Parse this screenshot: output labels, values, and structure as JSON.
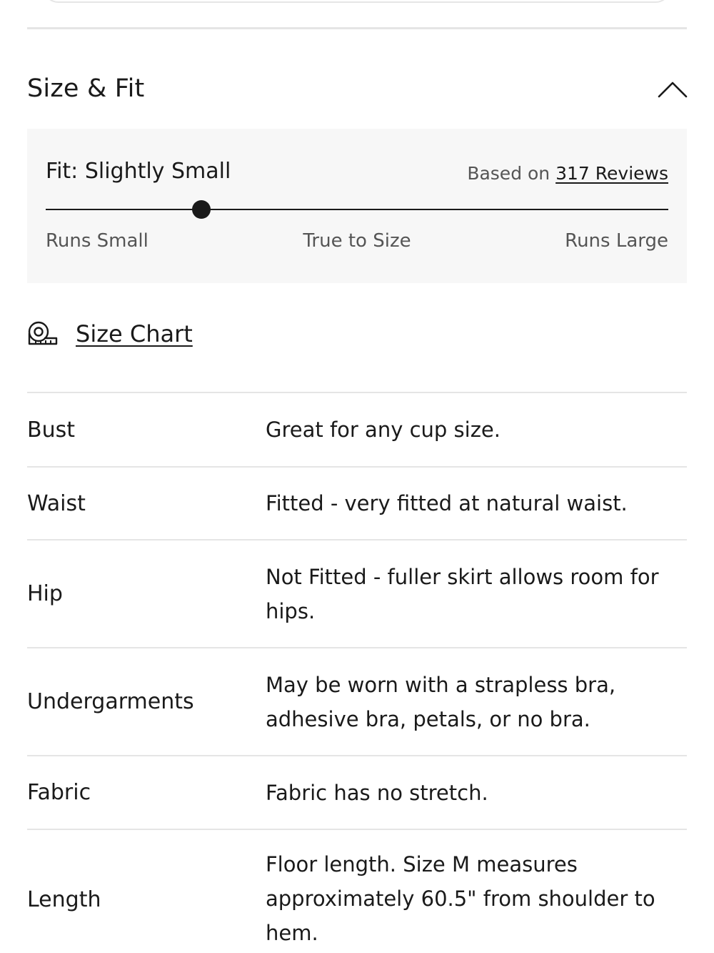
{
  "section": {
    "title": "Size & Fit"
  },
  "fit": {
    "label": "Fit: Slightly Small",
    "reviews_prefix": "Based on",
    "reviews_link": "317 Reviews",
    "position": 0.25,
    "scale": {
      "left": "Runs Small",
      "middle": "True to Size",
      "right": "Runs Large"
    }
  },
  "size_chart": {
    "icon": "measuring-tape-icon",
    "label": "Size Chart"
  },
  "fit_details": [
    {
      "label": "Bust",
      "value": "Great for any cup size."
    },
    {
      "label": "Waist",
      "value": "Fitted - very fitted at natural waist."
    },
    {
      "label": "Hip",
      "value": "Not Fitted - fuller skirt allows room for hips."
    },
    {
      "label": "Undergarments",
      "value": "May be worn with a strapless bra, adhesive bra, petals, or no bra."
    },
    {
      "label": "Fabric",
      "value": "Fabric has no stretch."
    },
    {
      "label": "Length",
      "value": "Floor length. Size M measures approximately 60.5\" from shoulder to hem."
    }
  ],
  "colors": {
    "text": "#1a1a1a",
    "muted": "#555555",
    "panel": "#f7f7f7",
    "divider": "#e5e5e5"
  }
}
